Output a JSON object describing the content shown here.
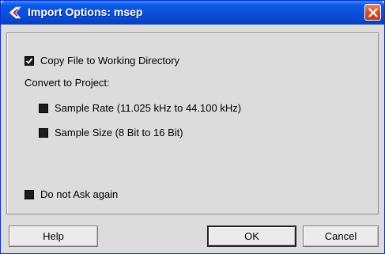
{
  "window": {
    "title": "Import Options: msep",
    "app_icon": "cubase-logo-icon",
    "close_icon": "close-icon"
  },
  "options": {
    "copy_file": {
      "label": "Copy File to Working Directory",
      "checked": true
    },
    "convert_heading": "Convert to Project:",
    "sample_rate": {
      "label": "Sample Rate (11.025 kHz to 44.100 kHz)",
      "checked": false
    },
    "sample_size": {
      "label": "Sample Size (8 Bit to 16 Bit)",
      "checked": false
    },
    "do_not_ask": {
      "label": "Do not Ask again",
      "checked": false
    }
  },
  "buttons": {
    "help": "Help",
    "ok": "OK",
    "cancel": "Cancel"
  },
  "colors": {
    "titlebar": "#0a4fd6",
    "dialog_bg": "#dcdcdc",
    "close_button": "#d94a25"
  }
}
